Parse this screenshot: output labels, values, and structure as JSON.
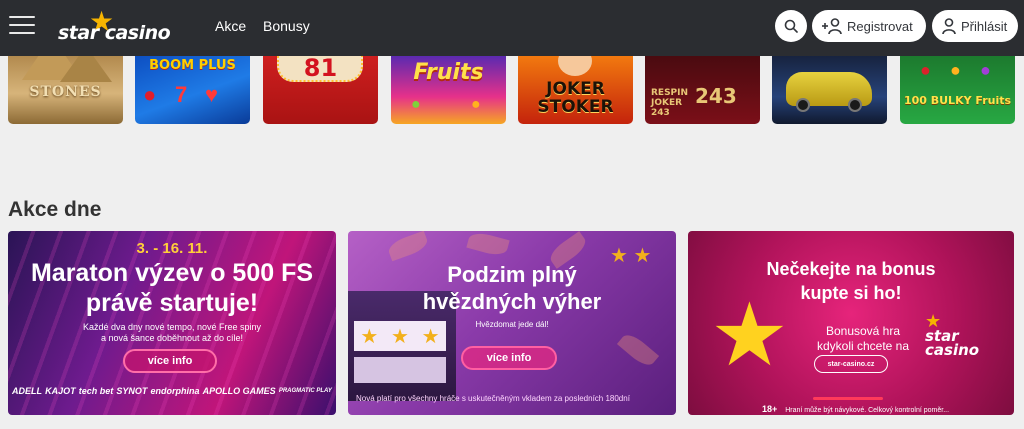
{
  "header": {
    "logo_text": "star casino",
    "nav": [
      {
        "label": "Akce"
      },
      {
        "label": "Bonusy"
      }
    ],
    "register_label": "Registrovat",
    "login_label": "Přihlásit"
  },
  "games": [
    {
      "title": "STONES"
    },
    {
      "title": "BOOM PLUS"
    },
    {
      "title": "81"
    },
    {
      "title": "Fruits"
    },
    {
      "title": "JOKER STOKER"
    },
    {
      "title": "RESPIN JOKER 243"
    },
    {
      "title": ""
    },
    {
      "title": "100 BULKY Fruits"
    }
  ],
  "section": {
    "title": "Akce dne"
  },
  "promos": [
    {
      "dates": "3. - 16. 11.",
      "headline_1": "Maraton výzev o 500 FS",
      "headline_2": "právě startuje!",
      "sub_1": "Každé dva dny nové tempo, nové Free spiny",
      "sub_2": "a nová šance doběhnout až do cíle!",
      "button": "více info",
      "providers": [
        "ADELL",
        "KAJOT",
        "tech bet",
        "SYNOT",
        "endorphina",
        "APOLLO GAMES",
        "PRAGMATIC PLAY"
      ]
    },
    {
      "headline_1": "Podzim plný",
      "headline_2": "hvězdných výher",
      "sub": "Hvězdomat jede dál!",
      "button": "více info",
      "note": "Nová platí pro všechny hráče s uskutečněným vkladem za posledních 180dní"
    },
    {
      "headline_1": "Nečekejte na bonus",
      "headline_2": "kupte si ho!",
      "sub_1": "Bonusová hra",
      "sub_2": "kdykoli chcete na",
      "url": "star-casino.cz",
      "logo": "star casino",
      "age": "18+",
      "footer": "Hraní může být návykové. Celkový kontrolní poměr..."
    }
  ],
  "colors": {
    "header_bg": "#2b2d31",
    "accent_yellow": "#f6b400",
    "page_bg": "#efefef"
  }
}
